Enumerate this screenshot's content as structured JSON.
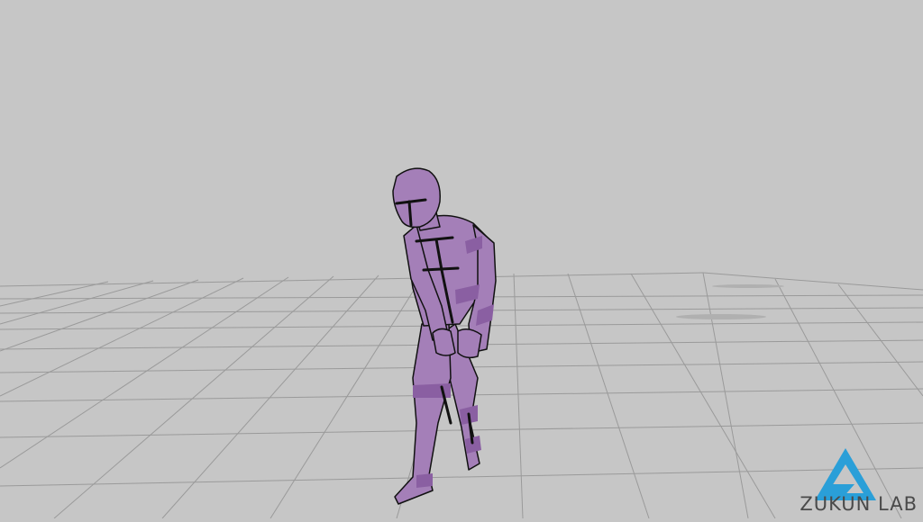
{
  "scene": {
    "background_color": "#c6c6c6",
    "grid_line_color": "#9a9a9a",
    "figure_fill_color": "#a47fb8",
    "figure_band_color": "#8a5fa2",
    "figure_line_color": "#111111"
  },
  "brand": {
    "logo_icon": "triangle-logo-icon",
    "logo_color": "#2a9fd8",
    "name": "ZUKUN LAB"
  }
}
